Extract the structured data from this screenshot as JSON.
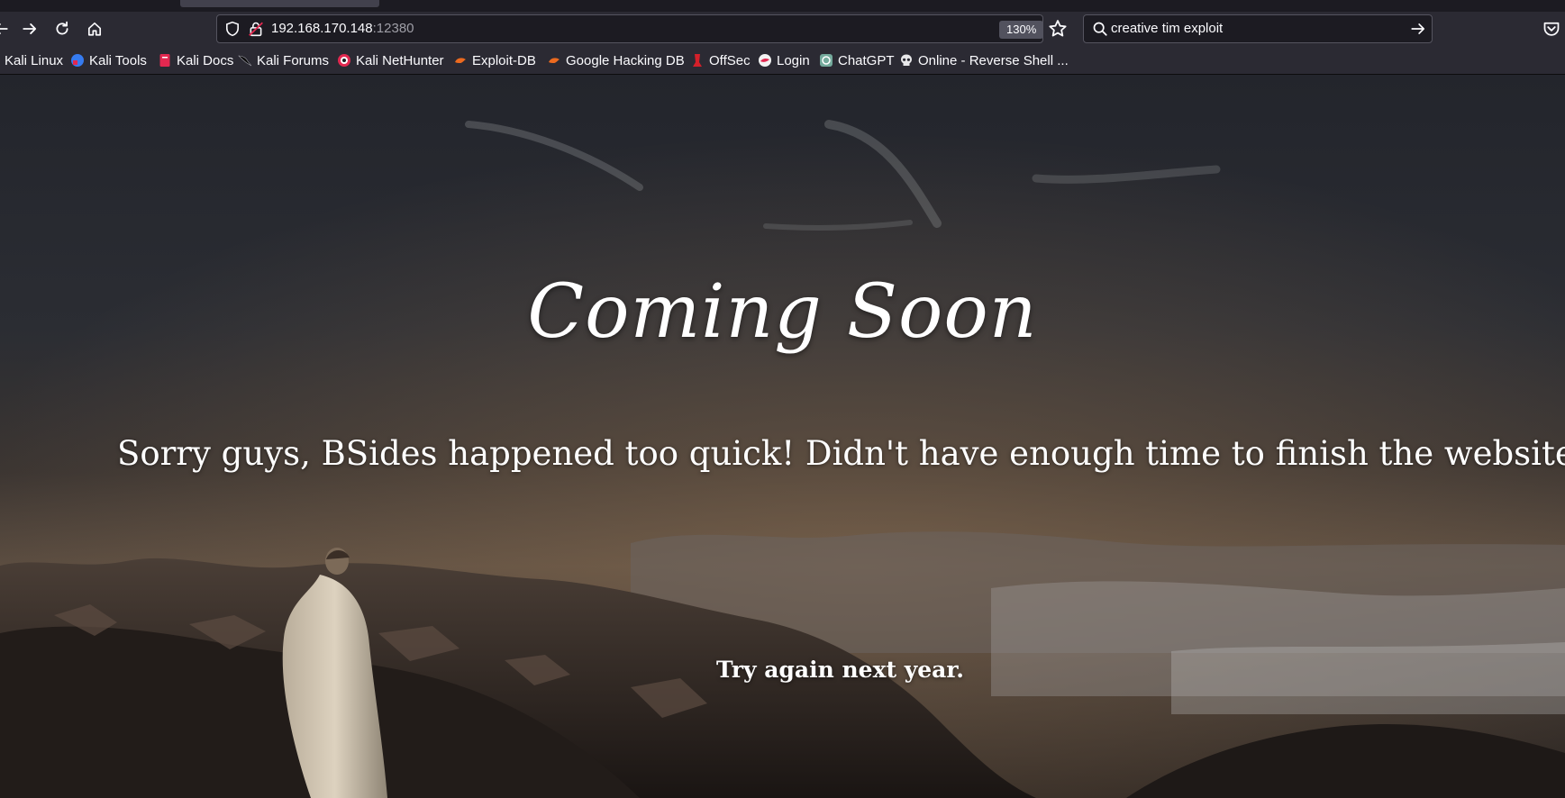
{
  "browser": {
    "url_host": "192.168.170.148",
    "url_port": ":12380",
    "zoom": "130%",
    "search_query": "creative tim exploit",
    "icons": [
      "back-icon",
      "forward-icon",
      "reload-icon",
      "home-icon",
      "shield-icon",
      "insecure-lock-icon",
      "star-icon",
      "search-icon",
      "arrow-right-icon",
      "pocket-icon"
    ]
  },
  "bookmarks": [
    {
      "label": "Kali Linux",
      "icon": "none"
    },
    {
      "label": "Kali Tools",
      "icon": "kali-tools-icon"
    },
    {
      "label": "Kali Docs",
      "icon": "kali-docs-icon"
    },
    {
      "label": "Kali Forums",
      "icon": "kali-forums-icon"
    },
    {
      "label": "Kali NetHunter",
      "icon": "nethunter-icon"
    },
    {
      "label": "Exploit-DB",
      "icon": "exploit-db-icon"
    },
    {
      "label": "Google Hacking DB",
      "icon": "ghdb-icon"
    },
    {
      "label": "OffSec",
      "icon": "offsec-icon"
    },
    {
      "label": "Login",
      "icon": "login-icon"
    },
    {
      "label": "ChatGPT",
      "icon": "chatgpt-icon"
    },
    {
      "label": "Online - Reverse Shell ...",
      "icon": "skull-icon"
    }
  ],
  "page": {
    "title": "Coming Soon",
    "subtitle": "Sorry guys, BSides happened too quick! Didn't have enough time to finish the website.",
    "footer": "Try again next year."
  },
  "colors": {
    "chrome_bg": "#2b2a33",
    "field_bg": "#1c1b22",
    "text": "#fbfbfe",
    "page_text": "#ffffff"
  }
}
